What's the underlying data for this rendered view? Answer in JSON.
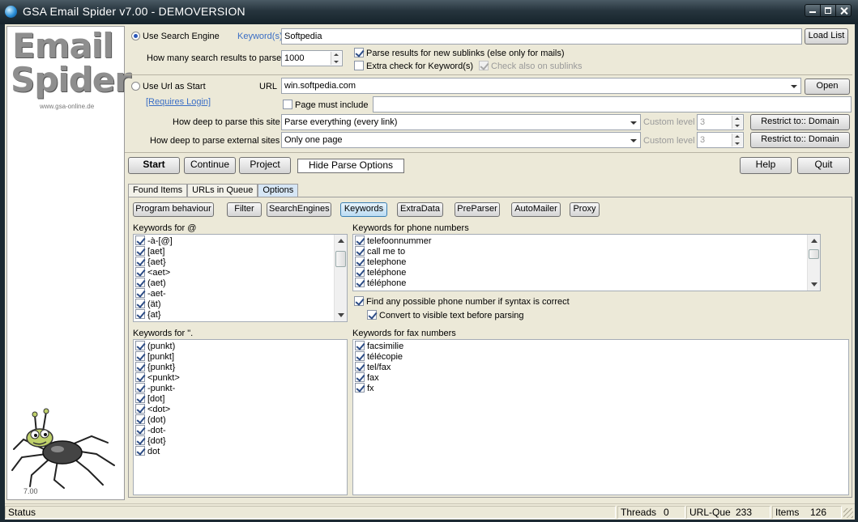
{
  "window": {
    "title": "GSA Email Spider v7.00 - DEMOVERSION"
  },
  "brand": {
    "logo_line1": "Email",
    "logo_line2": "Spider",
    "website": "www.gsa-online.de",
    "version": "7.00"
  },
  "search": {
    "use_search_engine_label": "Use Search Engine",
    "use_search_engine_selected": true,
    "keywords_label": "Keyword(s)",
    "keywords_value": "Softpedia",
    "load_list_label": "Load List",
    "results_label": "How many search results to parse",
    "results_value": "1000",
    "parse_sublinks_label": "Parse results for new sublinks (else only for mails)",
    "parse_sublinks_checked": true,
    "extra_check_label": "Extra check for Keyword(s)",
    "extra_check_checked": false,
    "check_sublinks_label": "Check also on sublinks",
    "check_sublinks_checked": true
  },
  "url_start": {
    "use_url_label": "Use Url as Start",
    "use_url_selected": false,
    "requires_login_label": "[Requires Login]",
    "url_label": "URL",
    "url_value": "win.softpedia.com",
    "open_label": "Open",
    "page_must_include_label": "Page must include",
    "page_must_include_checked": false,
    "page_must_include_value": "",
    "deep_site_label": "How deep to parse this site",
    "deep_site_value": "Parse everything (every link)",
    "deep_external_label": "How deep to parse external sites",
    "deep_external_value": "Only one page",
    "custom_level_label": "Custom level",
    "custom_level_site_value": "3",
    "custom_level_external_value": "3",
    "restrict_label": "Restrict to:: Domain"
  },
  "toolbar": {
    "start": "Start",
    "continue": "Continue",
    "project": "Project",
    "hide_parse": "Hide Parse Options",
    "help": "Help",
    "quit": "Quit"
  },
  "tabs": [
    {
      "label": "Found Items",
      "active": false
    },
    {
      "label": "URLs in Queue",
      "active": false
    },
    {
      "label": "Options",
      "active": true
    }
  ],
  "option_buttons": [
    {
      "label": "Program behaviour",
      "active": false
    },
    {
      "label": "Filter",
      "active": false
    },
    {
      "label": "SearchEngines",
      "active": false
    },
    {
      "label": "Keywords",
      "active": true
    },
    {
      "label": "ExtraData",
      "active": false
    },
    {
      "label": "PreParser",
      "active": false
    },
    {
      "label": "AutoMailer",
      "active": false
    },
    {
      "label": "Proxy",
      "active": false
    }
  ],
  "keywords_at": {
    "label": "Keywords for @",
    "items": [
      "-à-[@]",
      "[aet]",
      "{aet}",
      "<aet>",
      "(aet)",
      "-aet-",
      "(ät)",
      "{at}"
    ]
  },
  "keywords_dot": {
    "label": "Keywords for \".",
    "items": [
      "(punkt)",
      "[punkt]",
      "{punkt}",
      "<punkt>",
      "-punkt-",
      "[dot]",
      "<dot>",
      "(dot)",
      "-dot-",
      "{dot}",
      "dot"
    ]
  },
  "keywords_phone": {
    "label": "Keywords for phone numbers",
    "items": [
      "telefoonnummer",
      "call me to",
      "telephone",
      "teléphone",
      "téléphone"
    ],
    "find_any_label": "Find any possible phone number if syntax is correct",
    "find_any_checked": true,
    "convert_label": "Convert to visible text before parsing",
    "convert_checked": true
  },
  "keywords_fax": {
    "label": "Keywords for fax numbers",
    "items": [
      "facsimilie",
      "télécopie",
      "tel/fax",
      "fax",
      "fx"
    ]
  },
  "status": {
    "label": "Status",
    "threads_label": "Threads",
    "threads_value": "0",
    "urlque_label": "URL-Que",
    "urlque_value": "233",
    "items_label": "Items",
    "items_value": "126"
  },
  "colors": {
    "titlebar": "#26343d",
    "client": "#ece9d8",
    "active_tab": "#d6e6f5",
    "link_blue": "#3a6ec5",
    "logo_grey": "#8e8e8e"
  }
}
